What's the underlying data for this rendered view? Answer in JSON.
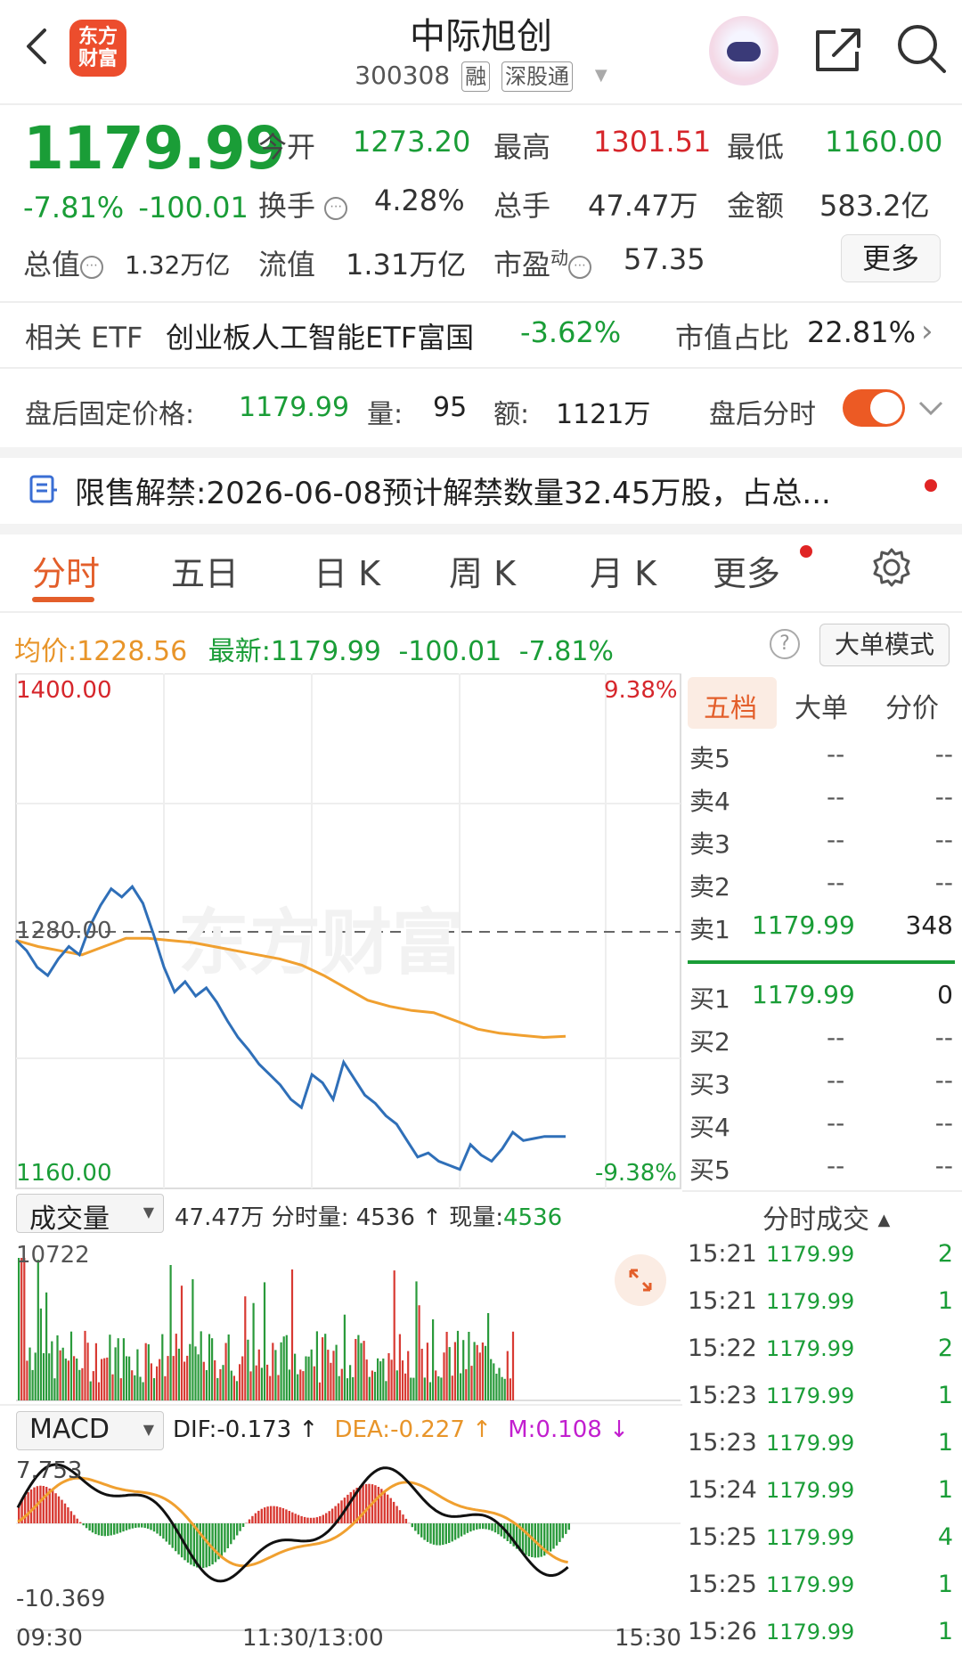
{
  "header": {
    "logo_text": "东方\n财富",
    "stock_name": "中际旭创",
    "stock_code": "300308",
    "tags": [
      "融",
      "深股通"
    ]
  },
  "quote": {
    "price": "1179.99",
    "change_pct": "-7.81%",
    "change_abs": "-100.01",
    "fields": [
      {
        "label": "今开",
        "value": "1273.20",
        "color": "#1a9d37"
      },
      {
        "label": "最高",
        "value": "1301.51",
        "color": "#d6262b"
      },
      {
        "label": "最低",
        "value": "1160.00",
        "color": "#1a9d37"
      },
      {
        "label": "换手",
        "value": "4.28%",
        "color": "#333333"
      },
      {
        "label": "总手",
        "value": "47.47万",
        "color": "#333333"
      },
      {
        "label": "金额",
        "value": "583.2亿",
        "color": "#333333"
      },
      {
        "label": "总值",
        "value": "1.32万亿",
        "color": "#333333"
      },
      {
        "label": "流值",
        "value": "1.31万亿",
        "color": "#333333"
      },
      {
        "label": "市盈",
        "value": "57.35",
        "color": "#333333"
      }
    ],
    "pe_superscript": "动",
    "more_label": "更多"
  },
  "etf": {
    "label": "相关 ETF",
    "name": "创业板人工智能ETF富国",
    "change": "-3.62%",
    "weight_label": "市值占比",
    "weight_value": "22.81%"
  },
  "after_hours": {
    "price_label": "盘后固定价格:",
    "price_value": "1179.99",
    "volume_label": "量:",
    "volume_value": "95",
    "amount_label": "额:",
    "amount_value": "1121万",
    "toggle_label": "盘后分时",
    "toggle_on": true
  },
  "notice": {
    "label": "限售解禁:",
    "text": "2026-06-08预计解禁数量32.45万股，占总..."
  },
  "tabs": [
    "分时",
    "五日",
    "日 K",
    "周 K",
    "月 K",
    "更多"
  ],
  "info_bar": {
    "avg_label": "均价:",
    "avg_value": "1228.56",
    "latest_label": "最新:",
    "latest_value": "1179.99",
    "latest_chg": "-100.01",
    "latest_pct": "-7.81%",
    "mode_button": "大单模式"
  },
  "price_chart": {
    "y_top": "1400.00",
    "y_mid": "1280.00",
    "y_bottom": "1160.00",
    "pct_top": "9.38%",
    "pct_bottom": "-9.38%",
    "watermark": "东方财富",
    "time_labels": [
      "09:30",
      "11:30/13:00",
      "15:30"
    ]
  },
  "orderbook": {
    "tabs": [
      "五档",
      "大单",
      "分价"
    ],
    "sells": [
      {
        "label": "卖5",
        "price": "--",
        "vol": "--"
      },
      {
        "label": "卖4",
        "price": "--",
        "vol": "--"
      },
      {
        "label": "卖3",
        "price": "--",
        "vol": "--"
      },
      {
        "label": "卖2",
        "price": "--",
        "vol": "--"
      },
      {
        "label": "卖1",
        "price": "1179.99",
        "vol": "348"
      }
    ],
    "buys": [
      {
        "label": "买1",
        "price": "1179.99",
        "vol": "0"
      },
      {
        "label": "买2",
        "price": "--",
        "vol": "--"
      },
      {
        "label": "买3",
        "price": "--",
        "vol": "--"
      },
      {
        "label": "买4",
        "price": "--",
        "vol": "--"
      },
      {
        "label": "买5",
        "price": "--",
        "vol": "--"
      }
    ]
  },
  "volume_panel": {
    "selector": "成交量",
    "total": "47.47万",
    "tick_vol_label": "分时量: 4536",
    "current_label": "现量:",
    "current_value": "4536",
    "max_label": "10722"
  },
  "ticks": {
    "title": "分时成交",
    "rows": [
      {
        "time": "15:21",
        "price": "1179.99",
        "vol": "2"
      },
      {
        "time": "15:21",
        "price": "1179.99",
        "vol": "1"
      },
      {
        "time": "15:22",
        "price": "1179.99",
        "vol": "2"
      },
      {
        "time": "15:23",
        "price": "1179.99",
        "vol": "1"
      },
      {
        "time": "15:23",
        "price": "1179.99",
        "vol": "1"
      },
      {
        "time": "15:24",
        "price": "1179.99",
        "vol": "1"
      },
      {
        "time": "15:25",
        "price": "1179.99",
        "vol": "4"
      },
      {
        "time": "15:25",
        "price": "1179.99",
        "vol": "1"
      },
      {
        "time": "15:26",
        "price": "1179.99",
        "vol": "1"
      }
    ]
  },
  "macd": {
    "selector": "MACD",
    "dif": "DIF:-0.173",
    "dea": "DEA:-0.227",
    "m": "M:0.108",
    "y_top": "7.753",
    "y_bottom": "-10.369"
  },
  "chart_data": {
    "type": "line",
    "series": [
      {
        "values": [
          1275,
          1270,
          1262,
          1258,
          1266,
          1272,
          1268,
          1282,
          1292,
          1300,
          1296,
          1301,
          1293,
          1278,
          1262,
          1250,
          1255,
          1248,
          1252,
          1245,
          1236,
          1228,
          1222,
          1215,
          1210,
          1205,
          1198,
          1194,
          1210,
          1206,
          1198,
          1216,
          1208,
          1200,
          1196,
          1190,
          1186,
          1178,
          1170,
          1172,
          1168,
          1166,
          1164,
          1176,
          1171,
          1168,
          1174,
          1182,
          1178,
          1179,
          1180,
          1180,
          1180
        ]
      },
      {
        "values": [
          1275,
          1272,
          1270,
          1268,
          1272,
          1276,
          1276,
          1275,
          1274,
          1272,
          1270,
          1268,
          1266,
          1263,
          1258,
          1252,
          1246,
          1243,
          1241,
          1240,
          1236,
          1232,
          1230,
          1229,
          1228,
          1228.56
        ]
      }
    ],
    "ylim": [
      1160,
      1400
    ]
  }
}
